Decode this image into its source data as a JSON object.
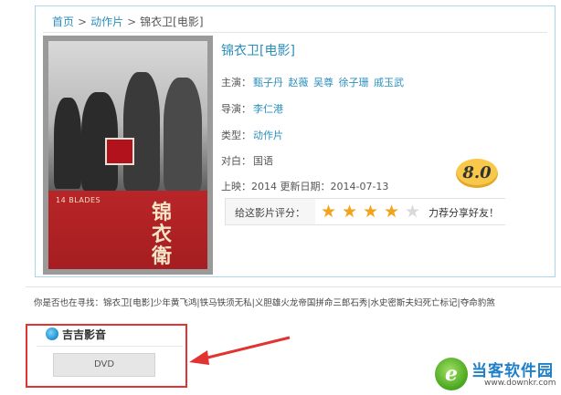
{
  "breadcrumb": {
    "home": "首页",
    "category": "动作片",
    "current": "锦衣卫[电影]",
    "separator": ">"
  },
  "poster": {
    "english_title": "14 BLADES",
    "chinese_title": "锦衣衛"
  },
  "movie": {
    "title": "锦衣卫[电影]",
    "cast_label": "主演：",
    "cast": [
      "甄子丹",
      "赵薇",
      "吴尊",
      "徐子珊",
      "戚玉武"
    ],
    "director_label": "导演：",
    "director": "李仁港",
    "genre_label": "类型：",
    "genre": "动作片",
    "dialogue_label": "对白：",
    "dialogue": "国语",
    "release_text": "上映：2014 更新日期：2014-07-13",
    "score": "8.0"
  },
  "rating": {
    "label": "给这影片评分：",
    "stars_filled": 4,
    "stars_total": 5,
    "share_text": "力荐分享好友！",
    "star_color": "#f2a21b"
  },
  "related": {
    "prefix": "你是否也在寻找：",
    "items": "锦衣卫[电影]少年黄飞鸿|铁马铁须无私|义胆雄火龙帝国拼命三郎石秀|水史密斯夫妇死亡标记|夺命豹煞"
  },
  "player": {
    "name": "吉吉影音",
    "button_label": "DVD"
  },
  "watermark": {
    "name": "当客软件园",
    "url": "www.downkr.com"
  },
  "colors": {
    "link": "#2a8fbd",
    "highlight_box": "#e23333",
    "panel_border": "#a9d6ea",
    "score_badge": "#f7c84a"
  }
}
